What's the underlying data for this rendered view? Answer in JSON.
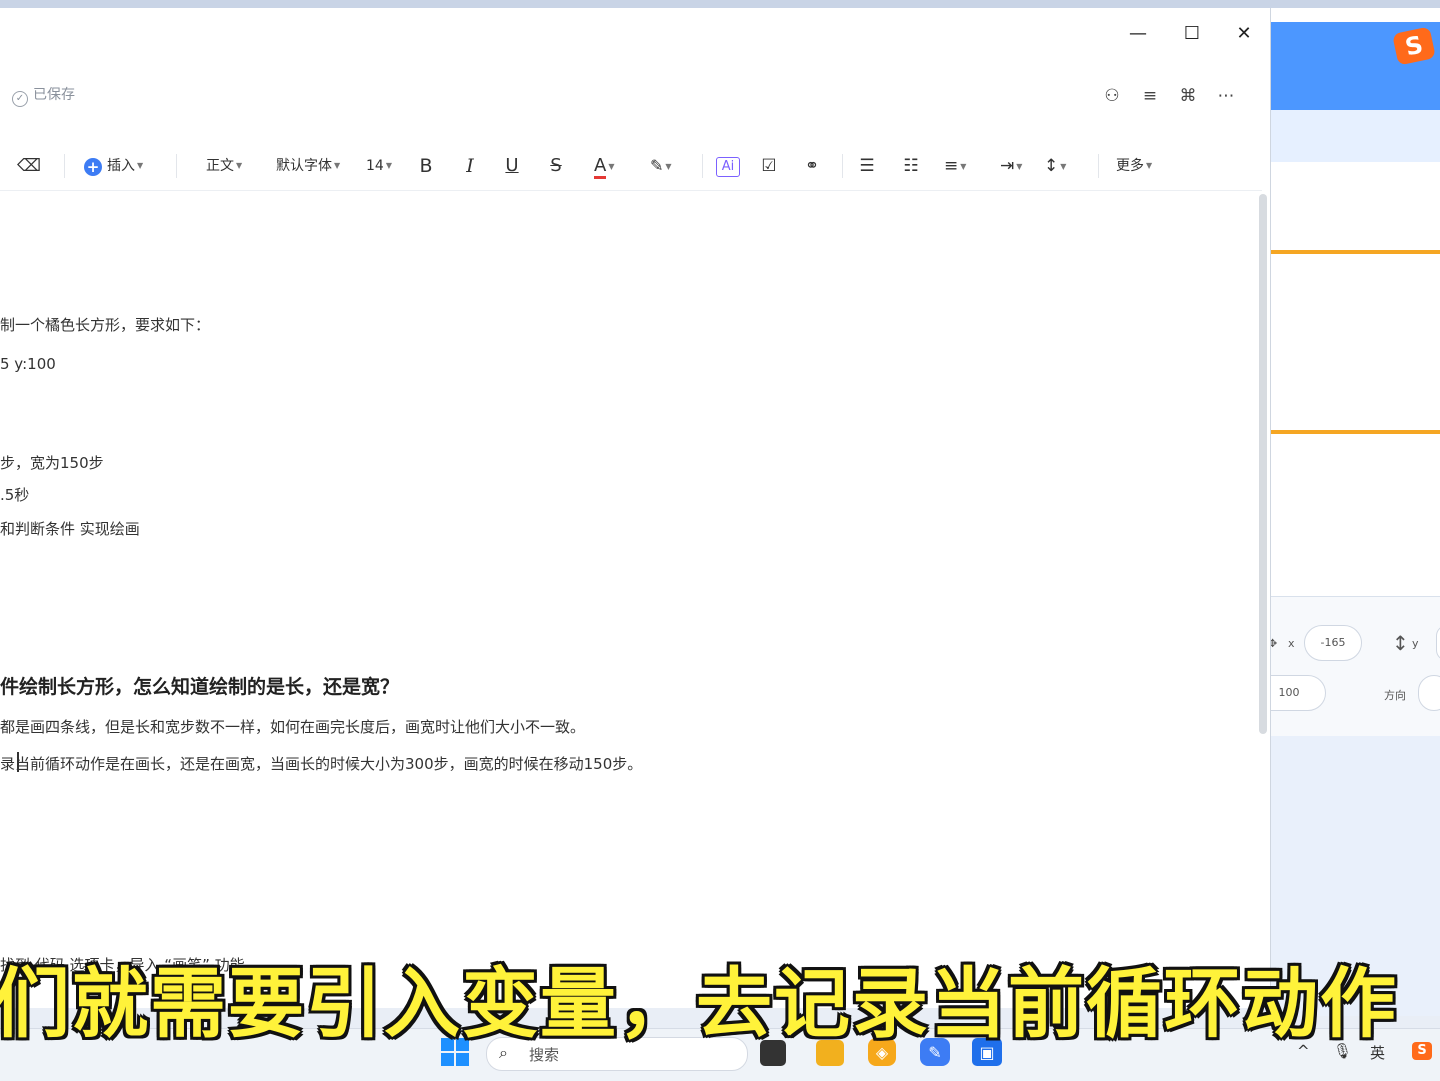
{
  "window": {
    "saved_status": "已保存",
    "controls": {
      "minimize": "—",
      "maximize": "☐",
      "close": "✕"
    }
  },
  "toolbar": {
    "insert": "插入",
    "paragraph_style": "正文",
    "font_family": "默认字体",
    "font_size": "14",
    "bold": "B",
    "italic": "I",
    "underline": "U",
    "strikethrough": "S",
    "font_color": "A",
    "more": "更多"
  },
  "document": {
    "lines": [
      "制一个橘色长方形，要求如下：",
      "5 y:100",
      "步，宽为150步",
      ".5秒",
      "和判断条件 实现绘画"
    ],
    "heading": "件绘制长方形，怎么知道绘制的是长，还是宽？",
    "para1": "都是画四条线，但是长和宽步数不一样，如何在画完长度后，画宽时让他们大小不一致。",
    "para2": "录当前循环动作是在画长，还是在画宽，当画长的时候大小为300步，画宽的时候在移动150步。",
    "bottom_line": "找到 代码 选项卡，导入 “画笔” 功能"
  },
  "background_app": {
    "x_label": "x",
    "x_value": "-165",
    "y_label": "y",
    "size_value": "100",
    "direction_label": "方向"
  },
  "subtitle": "们就需要引入变量，去记录当前循环动作",
  "taskbar": {
    "search_placeholder": "搜索",
    "ime_label": "英"
  }
}
